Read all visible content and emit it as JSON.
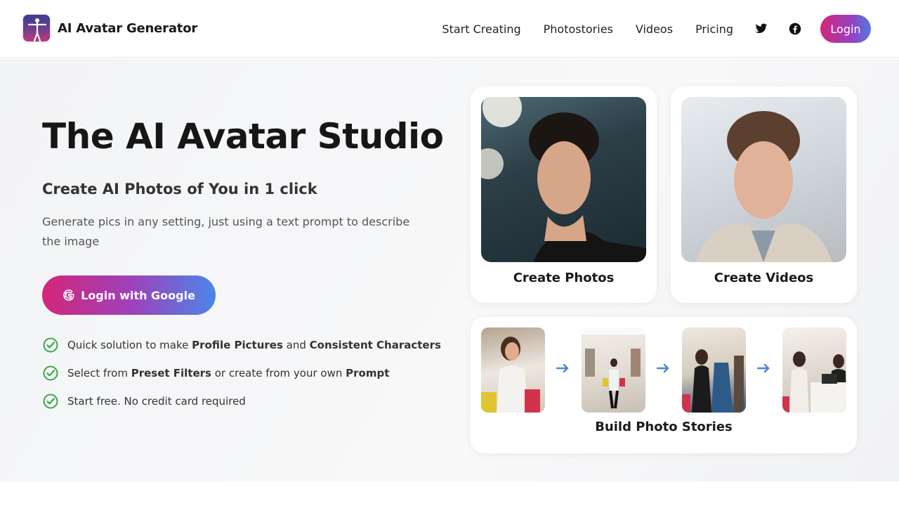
{
  "header": {
    "brand_name": "AI Avatar Generator",
    "logo_icon": "human-figure-logo",
    "nav": [
      {
        "label": "Start Creating"
      },
      {
        "label": "Photostories"
      },
      {
        "label": "Videos"
      },
      {
        "label": "Pricing"
      }
    ],
    "social_icons": [
      "twitter-icon",
      "facebook-icon"
    ],
    "login_label": "Login"
  },
  "hero": {
    "title": "The AI Avatar Studio",
    "subtitle": "Create AI Photos of You in 1 click",
    "description": "Generate pics in any setting, just using a text prompt to describe the image",
    "google_button_label": "Login with Google",
    "features": [
      {
        "parts": [
          {
            "text": "Quick solution to make ",
            "bold": false
          },
          {
            "text": "Profile Pictures",
            "bold": true
          },
          {
            "text": " and ",
            "bold": false
          },
          {
            "text": "Consistent Characters",
            "bold": true
          }
        ]
      },
      {
        "parts": [
          {
            "text": "Select from ",
            "bold": false
          },
          {
            "text": "Preset Filters",
            "bold": true
          },
          {
            "text": " or create from your own ",
            "bold": false
          },
          {
            "text": "Prompt",
            "bold": true
          }
        ]
      },
      {
        "parts": [
          {
            "text": "Start free. No credit card required",
            "bold": false
          }
        ]
      }
    ]
  },
  "cards": {
    "photos_label": "Create Photos",
    "videos_label": "Create Videos",
    "stories_label": "Build Photo Stories"
  },
  "colors": {
    "accent_gradient_start": "#d4267a",
    "accent_gradient_end": "#4d7be0",
    "check_green": "#3aa84a",
    "arrow_blue": "#4a86d8"
  }
}
